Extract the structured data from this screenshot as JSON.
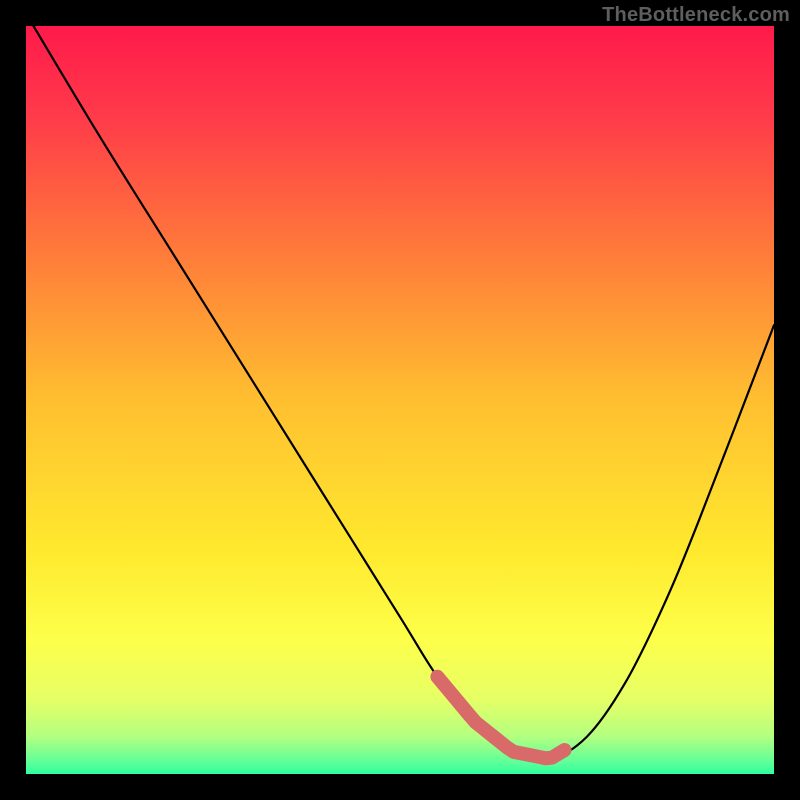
{
  "watermark": "TheBottleneck.com",
  "chart_data": {
    "type": "line",
    "title": "",
    "xlabel": "",
    "ylabel": "",
    "xlim": [
      0,
      100
    ],
    "ylim": [
      0,
      100
    ],
    "series": [
      {
        "name": "bottleneck-curve",
        "x": [
          1,
          10,
          20,
          30,
          40,
          50,
          55,
          60,
          65,
          70,
          75,
          80,
          85,
          90,
          100
        ],
        "values": [
          100,
          85,
          69,
          53,
          37,
          21,
          13,
          7,
          3,
          2,
          5,
          12,
          22,
          34,
          60
        ]
      }
    ],
    "highlight_band": {
      "name": "optimal-range",
      "x_range": [
        55,
        72
      ],
      "color": "#d86a6a"
    },
    "gradient_stops": [
      {
        "offset": 0.0,
        "color": "#ff1a4b"
      },
      {
        "offset": 0.12,
        "color": "#ff3a4a"
      },
      {
        "offset": 0.3,
        "color": "#ff7a3a"
      },
      {
        "offset": 0.5,
        "color": "#ffbf30"
      },
      {
        "offset": 0.7,
        "color": "#ffe92e"
      },
      {
        "offset": 0.82,
        "color": "#fdff4a"
      },
      {
        "offset": 0.9,
        "color": "#e6ff66"
      },
      {
        "offset": 0.95,
        "color": "#b3ff80"
      },
      {
        "offset": 0.985,
        "color": "#5cff99"
      },
      {
        "offset": 1.0,
        "color": "#2eff9e"
      }
    ]
  }
}
